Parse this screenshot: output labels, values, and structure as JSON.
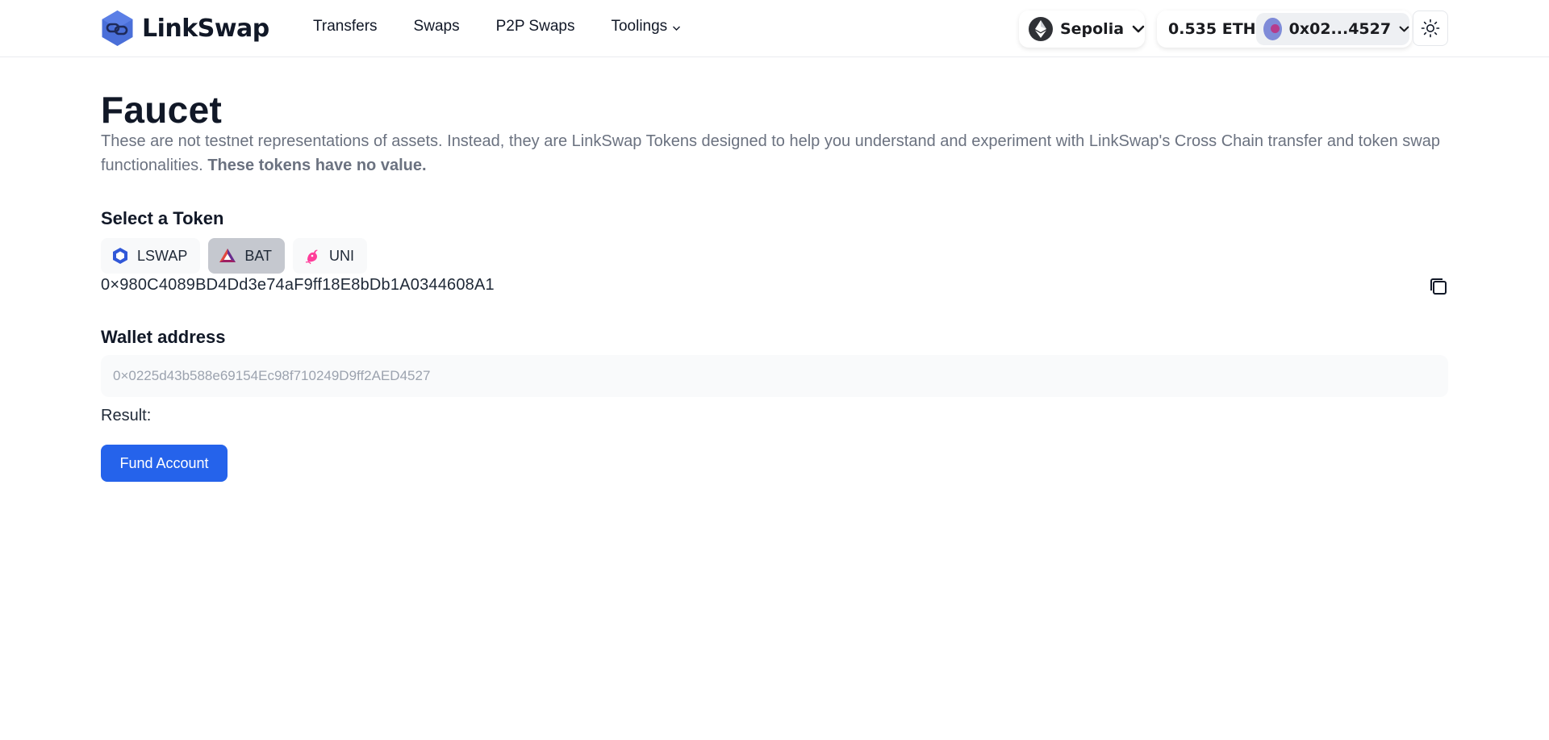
{
  "header": {
    "brand": "LinkSwap",
    "nav": {
      "transfers": "Transfers",
      "swaps": "Swaps",
      "p2p_swaps": "P2P Swaps",
      "toolings": "Toolings"
    },
    "network": "Sepolia",
    "balance": "0.535 ETH",
    "account": "0x02...4527"
  },
  "main": {
    "title": "Faucet",
    "description": "These are not testnet representations of assets. Instead, they are LinkSwap Tokens designed to help you understand and experiment with LinkSwap's Cross Chain transfer and token swap functionalities.",
    "description_bold": "These tokens have no value.",
    "select_token_label": "Select a Token",
    "tokens": [
      {
        "label": "LSWAP",
        "icon": "lswap-icon",
        "active": false
      },
      {
        "label": "BAT",
        "icon": "bat-icon",
        "active": true
      },
      {
        "label": "UNI",
        "icon": "uni-icon",
        "active": false
      }
    ],
    "token_address": "0×980C4089BD4Dd3e74aF9ff18E8bDb1A0344608A1",
    "wallet_label": "Wallet address",
    "wallet_placeholder": "0×0225d43b588e69154Ec98f710249D9ff2AED4527",
    "result_label": "Result:",
    "fund_button": "Fund Account"
  },
  "colors": {
    "accent": "#2563eb",
    "active_token_bg": "#c5c8cf",
    "muted_text": "#6b7280"
  }
}
